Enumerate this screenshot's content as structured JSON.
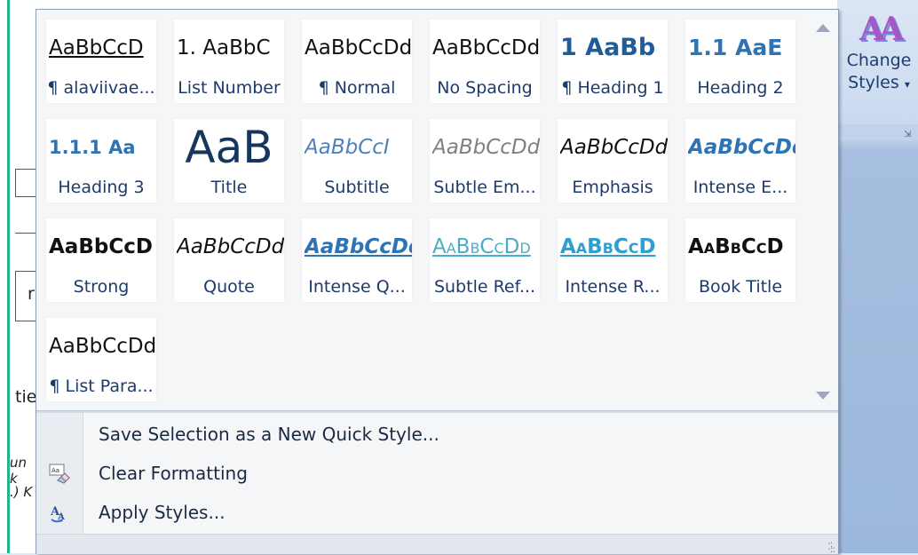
{
  "ribbon": {
    "change_styles_label_1": "Change",
    "change_styles_label_2": "Styles",
    "dropdown_caret": "▾",
    "launcher_glyph": "⇲"
  },
  "background_doc": {
    "fragment_1": "r",
    "fragment_2": "tie",
    "fragment_3": "un k",
    "fragment_4": ".) K"
  },
  "styles": [
    {
      "sample": "AaBbCcD",
      "name": "¶ alaviivae..."
    },
    {
      "sample": "1. AaBbC",
      "name": "List Number"
    },
    {
      "sample": "AaBbCcDd",
      "name": "¶ Normal"
    },
    {
      "sample": "AaBbCcDd",
      "name": "No Spacing"
    },
    {
      "sample": "1 AaBb",
      "name": "¶ Heading 1"
    },
    {
      "sample": "1.1 AaE",
      "name": "Heading 2"
    },
    {
      "sample": "1.1.1 Aa",
      "name": "Heading 3"
    },
    {
      "sample": "AaB",
      "name": "Title"
    },
    {
      "sample": "AaBbCcI",
      "name": "Subtitle"
    },
    {
      "sample": "AaBbCcDd",
      "name": "Subtle Em..."
    },
    {
      "sample": "AaBbCcDd",
      "name": "Emphasis"
    },
    {
      "sample": "AaBbCcDd",
      "name": "Intense E..."
    },
    {
      "sample": "AaBbCcD",
      "name": "Strong"
    },
    {
      "sample": "AaBbCcDd",
      "name": "Quote"
    },
    {
      "sample": "AaBbCcDd",
      "name": "Intense Q..."
    },
    {
      "sample": "AaBbCcDd",
      "name": "Subtle Ref..."
    },
    {
      "sample": "AaBbCcD",
      "name": "Intense R..."
    },
    {
      "sample": "AaBbCcD",
      "name": "Book Title"
    },
    {
      "sample": "AaBbCcDd",
      "name": "¶ List Para..."
    }
  ],
  "menu": {
    "save_selection": "Save Selection as a New Quick Style...",
    "clear_formatting": "Clear Formatting",
    "apply_styles": "Apply Styles..."
  },
  "colors": {
    "heading_blue": "#1f5c99",
    "accent_blue": "#2e74b5",
    "title_teal": "#17365d",
    "subtitle_blue": "#4f81bd",
    "subtle_gray": "#808080",
    "frame_green": "#20b48c"
  }
}
